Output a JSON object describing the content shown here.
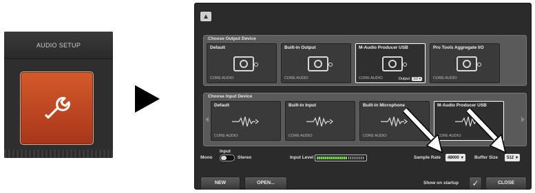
{
  "tile": {
    "title": "AUDIO SETUP",
    "icon": "wrench-icon"
  },
  "dialog": {
    "output_section": {
      "title": "Choose Output Device",
      "devices": [
        {
          "name": "Default",
          "type": "CORE AUDIO"
        },
        {
          "name": "Built-in Output",
          "type": "CORE AUDIO"
        },
        {
          "name": "M-Audio Producer USB",
          "type": "CORE AUDIO",
          "output_label": "Output",
          "output_value": "1/2"
        },
        {
          "name": "Pro Tools Aggregate I/O",
          "type": "CORE AUDIO"
        }
      ]
    },
    "input_section": {
      "title": "Choose Input Device",
      "devices": [
        {
          "name": "Default",
          "type": "CORE AUDIO"
        },
        {
          "name": "Built-in Input",
          "type": "CORE AUDIO"
        },
        {
          "name": "Built-in Microphone",
          "type": "CORE AUDIO"
        },
        {
          "name": "M-Audio Producer USB",
          "type": "CORE AUDIO"
        }
      ]
    },
    "controls": {
      "input_label": "Input",
      "mono_label": "Mono",
      "stereo_label": "Stereo",
      "input_level_label": "Input Level",
      "sample_rate_label": "Sample Rate",
      "sample_rate_value": "48000",
      "buffer_size_label": "Buffer Size",
      "buffer_size_value": "512"
    },
    "footer": {
      "new_label": "NEW",
      "open_label": "OPEN...",
      "show_on_startup_label": "Show on startup",
      "close_label": "CLOSE"
    }
  },
  "colors": {
    "accent": "#c24a22",
    "panel": "#5a5a5a",
    "dialog_bg": "#2b2b2b"
  }
}
